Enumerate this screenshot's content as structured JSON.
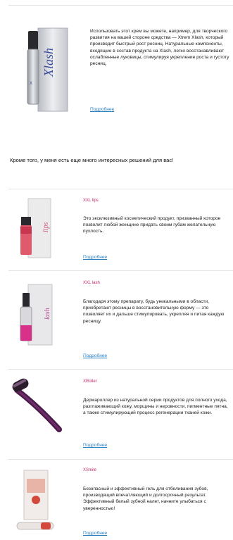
{
  "hero": {
    "text": "Использовать этот крем вы можете, например, для творческого развития на вашей стороне средства — Xtrem Xlash, который производит быстрый рост ресниц. Натуральные компоненты, входящие в состав продукта на Xlash, легко восстанавливают ослабленные луковицы, стимулируя укрепление роста и густоту ресниц.",
    "more_label": "Подробнее"
  },
  "headline": "Кроме того, у меня есть еще много интересных решений для вас!",
  "products": [
    {
      "tag": "XXL lips",
      "text": "Это эксклюзивный косметический продукт, призванный которое позволит любой женщине придать своим губам желательную пухлость.",
      "more_label": "Подробнее"
    },
    {
      "tag": "XXL lash",
      "text": "Благодаря этому препарату, будь уникальными в области, приобретают ресницы в восстановительную форму — это позволяет их и дальше стимулировать, укрепляя и питая каждую ресницу.",
      "more_label": "Подробнее"
    },
    {
      "tag": "XRoller",
      "text": "Дермароллер из натуральной серии продуктов для полного ухода, разглаживающий кожу, морщины и неровности, пигментные пятна, а также стимулирующий процесс регенерации тканей кожи.",
      "more_label": "Подробнее"
    },
    {
      "tag": "XSmile",
      "text": "Безопасный и эффективный гель для отбеливания зубов, производящий впечатляющий и долгосрочный результат. Эффективный белый зубной налет, начните улыбаться с уверенностью!",
      "more_label": "Подробнее"
    }
  ]
}
